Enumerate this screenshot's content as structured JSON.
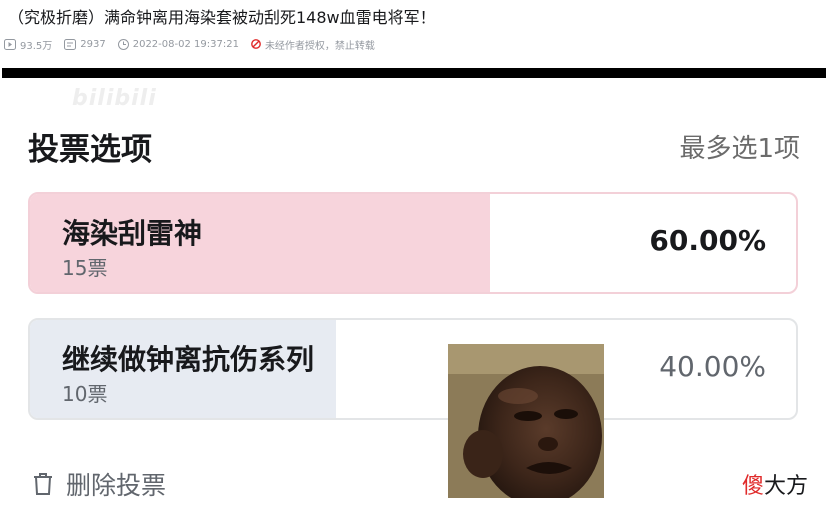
{
  "video": {
    "title": "（究极折磨）满命钟离用海染套被动刮死148w血雷电将军！",
    "views": "93.5万",
    "comments": "2937",
    "datetime": "2022-08-02 19:37:21",
    "copyright": "未经作者授权，禁止转载"
  },
  "watermark": "bilibili",
  "poll": {
    "header": "投票选项",
    "hint": "最多选1项",
    "options": [
      {
        "label": "海染刮雷神",
        "votes": "15票",
        "percent": "60.00%",
        "share": 0.6
      },
      {
        "label": "继续做钟离抗伤系列",
        "votes": "10票",
        "percent": "40.00%",
        "share": 0.4
      }
    ],
    "delete_label": "删除投票"
  },
  "channel_tag": {
    "accent": "傻",
    "rest": "大方"
  },
  "colors": {
    "selected_fill": "#f7d4dc",
    "unselected_fill": "#e7ebf2",
    "accent_red": "#e02a2a",
    "meta_gray": "#9499a0"
  }
}
